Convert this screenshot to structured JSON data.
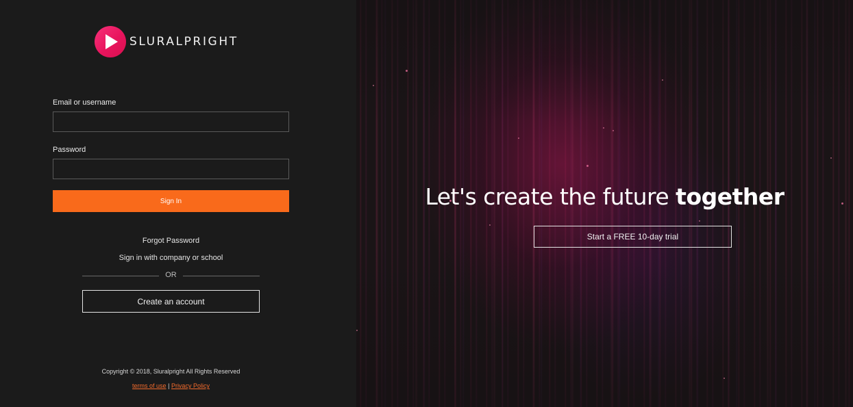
{
  "brand": {
    "name": "SLURALPRIGHT",
    "logo_color": "#e8145d"
  },
  "login": {
    "email_label": "Email or username",
    "email_value": "",
    "password_label": "Password",
    "password_value": "",
    "signin_label": "Sign In",
    "signin_color": "#f96a1b",
    "forgot_password": "Forgot Password",
    "company_signin": "Sign in with company or school",
    "or_text": "OR",
    "create_account": "Create an account"
  },
  "footer": {
    "copyright": "Copyright © 2018, Sluralpright All Rights Reserved",
    "terms_label": "terms of use",
    "separator": "|",
    "privacy_label": "Privacy Policy",
    "link_color": "#f46b2c"
  },
  "hero": {
    "headline_prefix": "Let's create the future ",
    "headline_bold": "together",
    "trial_button": "Start a FREE 10-day trial",
    "accent_color": "#a0145a"
  }
}
